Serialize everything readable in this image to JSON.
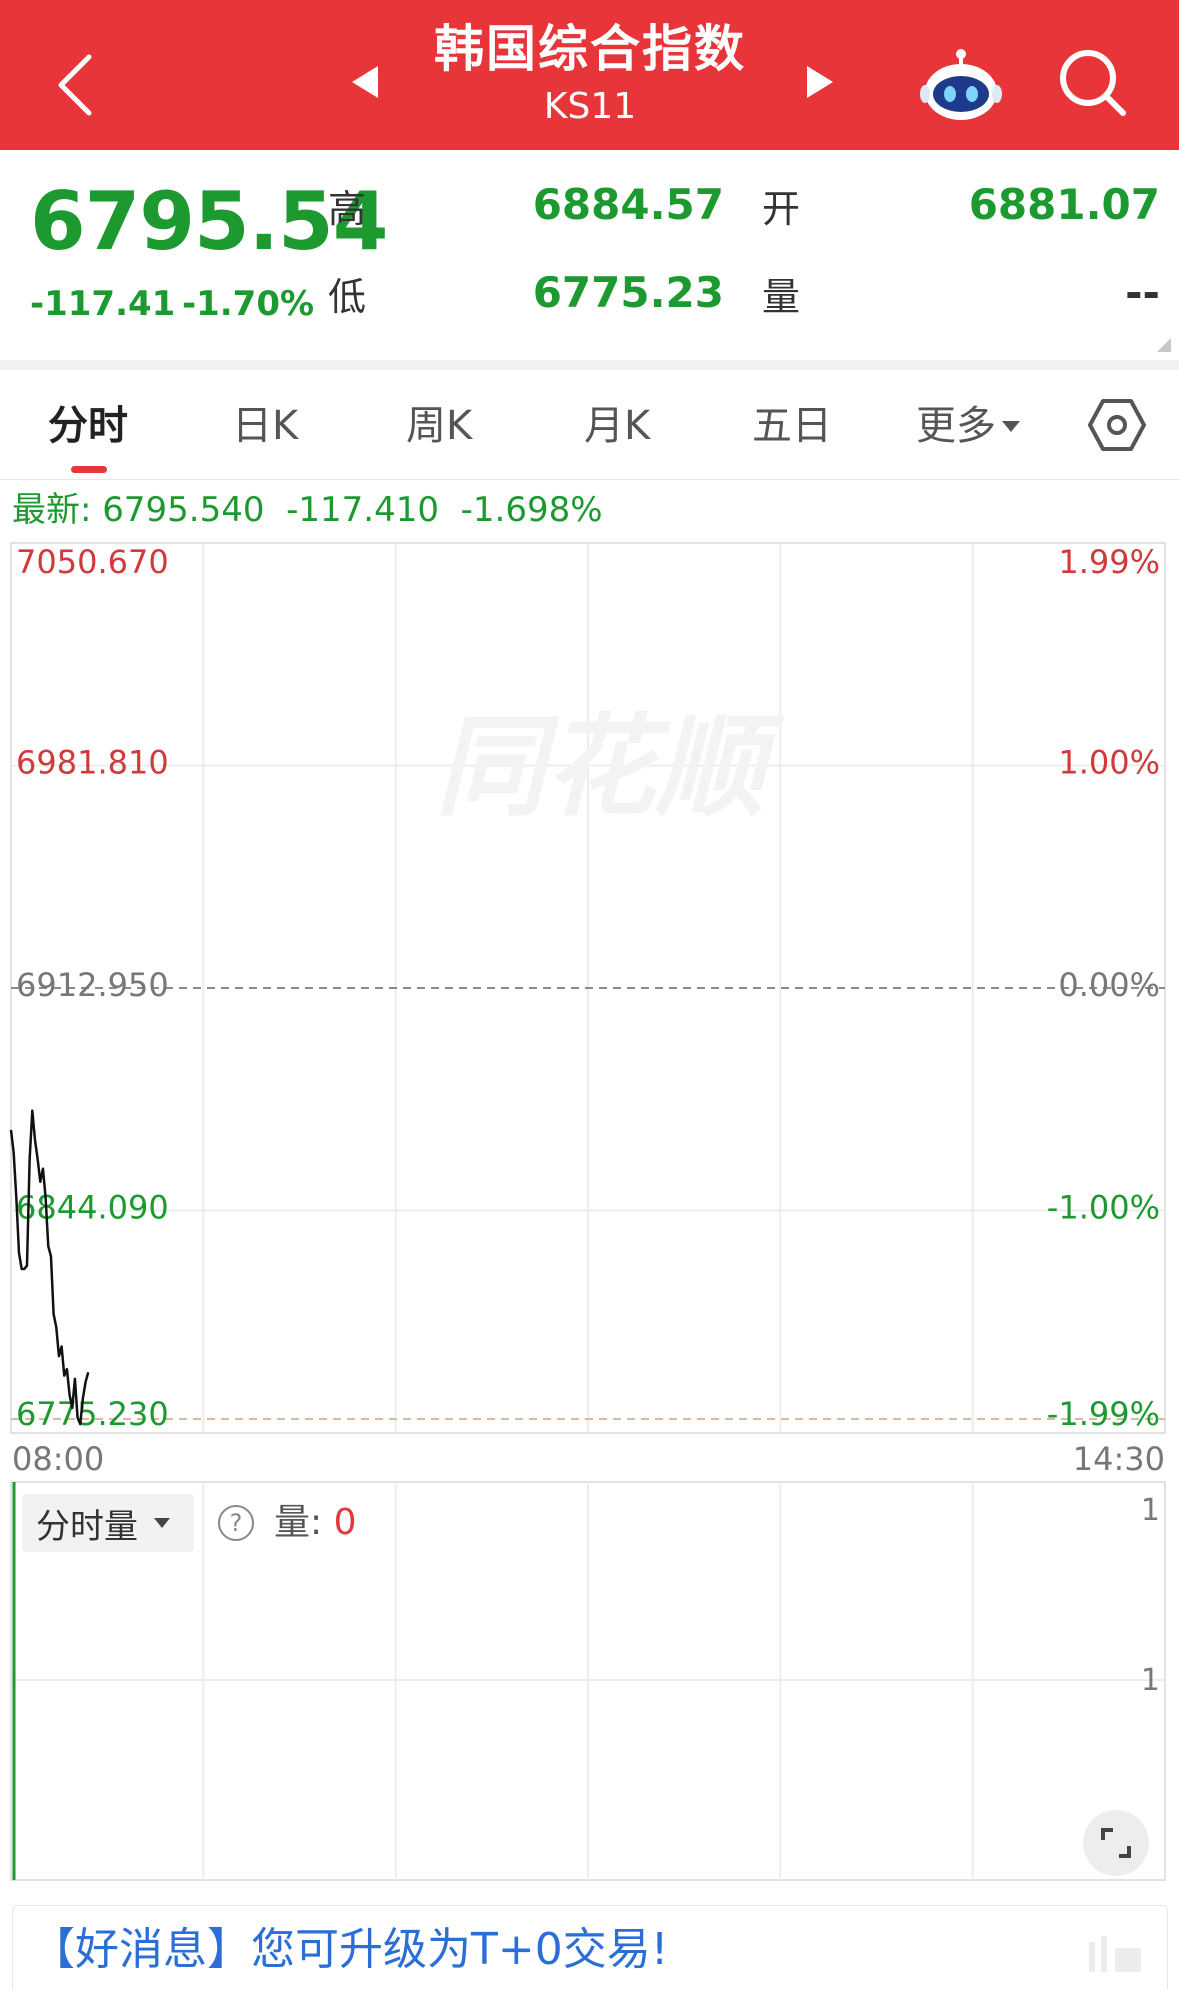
{
  "header": {
    "title": "韩国综合指数",
    "code": "KS11",
    "icons": {
      "back": "chevron-left-icon",
      "prev": "triangle-left-icon",
      "next": "triangle-right-icon",
      "assistant": "robot-icon",
      "search": "search-icon"
    },
    "bg_color": "#e8353a"
  },
  "quote": {
    "price": "6795.54",
    "change": "-117.41",
    "change_pct": "-1.70%",
    "high_label": "高",
    "high": "6884.57",
    "low_label": "低",
    "low": "6775.23",
    "open_label": "开",
    "open": "6881.07",
    "volume_label": "量",
    "volume": "--",
    "down_color": "#1d9a2f"
  },
  "tabs": {
    "items": [
      "分时",
      "日K",
      "周K",
      "月K",
      "五日",
      "更多"
    ],
    "active_index": 0,
    "settings_icon": "settings-hexagon-icon"
  },
  "latest": {
    "label": "最新:",
    "price": "6795.540",
    "change": "-117.410",
    "change_pct": "-1.698%"
  },
  "chart_data": {
    "type": "line",
    "y_ticks_left": [
      "7050.670",
      "6981.810",
      "6912.950",
      "6844.090",
      "6775.230"
    ],
    "y_ticks_right": [
      "1.99%",
      "1.00%",
      "0.00%",
      "-1.00%",
      "-1.99%"
    ],
    "ylim": [
      6775.23,
      7050.67
    ],
    "prev_close": 6912.95,
    "low_line": 6775.23,
    "x_start_label": "08:00",
    "x_end_label": "14:30",
    "total_minutes": 390,
    "series": [
      {
        "values": [
          6869,
          6862,
          6848,
          6831,
          6826,
          6826,
          6827,
          6860,
          6875,
          6866,
          6860,
          6853,
          6857,
          6848,
          6833,
          6830,
          6812,
          6808,
          6799,
          6802,
          6793,
          6795,
          6787,
          6783,
          6792,
          6780,
          6778,
          6786,
          6791,
          6794
        ]
      }
    ],
    "watermark": "同花顺",
    "up_color": "#d03a3a",
    "down_color": "#1d9a2f"
  },
  "volume": {
    "selector_label": "分时量",
    "help_icon": "question-circle-icon",
    "label": "量:",
    "value": "0",
    "axis_top": "1",
    "axis_mid": "1",
    "expand_icon": "expand-icon"
  },
  "banner": {
    "text": "【好消息】您可升级为T+0交易!"
  }
}
